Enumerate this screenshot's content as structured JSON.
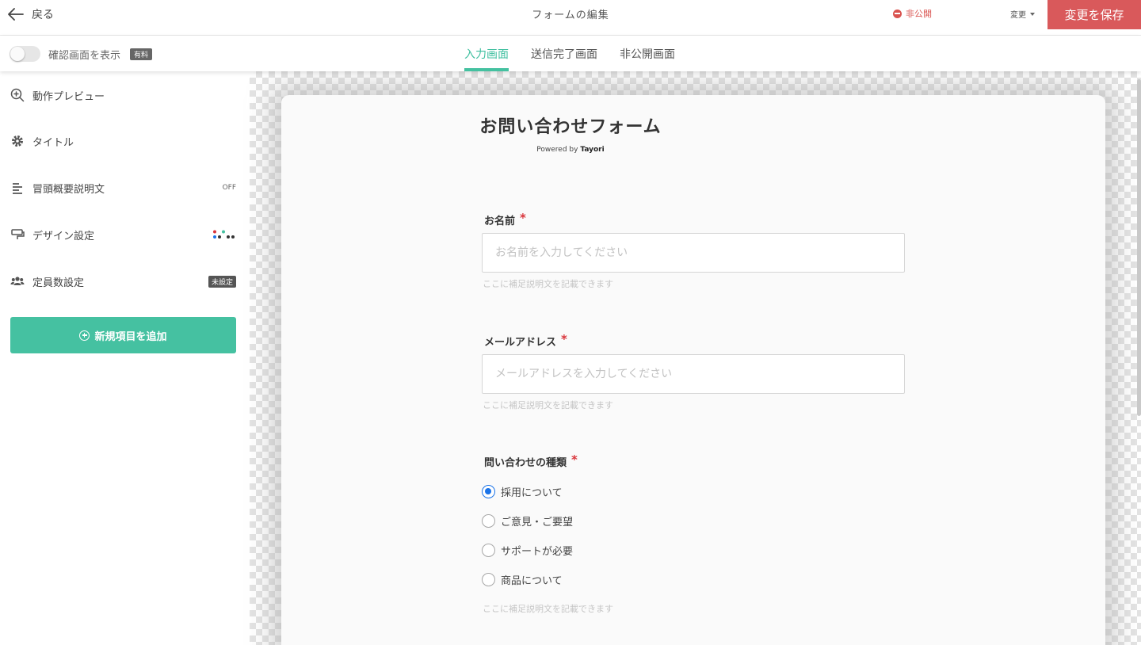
{
  "header": {
    "back_label": "戻る",
    "title": "フォームの編集",
    "status_label": "非公開",
    "change_label": "変更",
    "save_label": "変更を保存"
  },
  "subbar": {
    "confirm_label": "確認画面を表示",
    "paid_badge": "有料",
    "tabs": [
      {
        "label": "入力画面",
        "active": true
      },
      {
        "label": "送信完了画面",
        "active": false
      },
      {
        "label": "非公開画面",
        "active": false
      }
    ]
  },
  "sidebar": {
    "items": [
      {
        "label": "動作プレビュー",
        "icon": "zoom-in-icon"
      },
      {
        "label": "タイトル",
        "icon": "gear-icon"
      },
      {
        "label": "冒頭概要説明文",
        "icon": "text-align-icon",
        "right": "OFF"
      },
      {
        "label": "デザイン設定",
        "icon": "paint-roller-icon"
      },
      {
        "label": "定員数設定",
        "icon": "users-icon",
        "right": "未設定"
      }
    ],
    "add_button": "新規項目を追加"
  },
  "form": {
    "title": "お問い合わせフォーム",
    "powered_prefix": "Powered by",
    "powered_brand": "Tayori",
    "fields": [
      {
        "label": "お名前",
        "required_mark": "*",
        "placeholder": "お名前を入力してください",
        "help": "ここに補足説明文を記載できます"
      },
      {
        "label": "メールアドレス",
        "required_mark": "*",
        "placeholder": "メールアドレスを入力してください",
        "help": "ここに補足説明文を記載できます"
      }
    ],
    "radio_field": {
      "label": "問い合わせの種類",
      "required_mark": "*",
      "options": [
        "採用について",
        "ご意見・ご要望",
        "サポートが必要",
        "商品について"
      ],
      "selected": "採用について",
      "help": "ここに補足説明文を記載できます"
    }
  },
  "colors": {
    "accent": "#44c1a0",
    "save": "#d9595b",
    "status": "#d9534f",
    "required": "#d9343a",
    "radio_selected": "#1a73e8"
  }
}
